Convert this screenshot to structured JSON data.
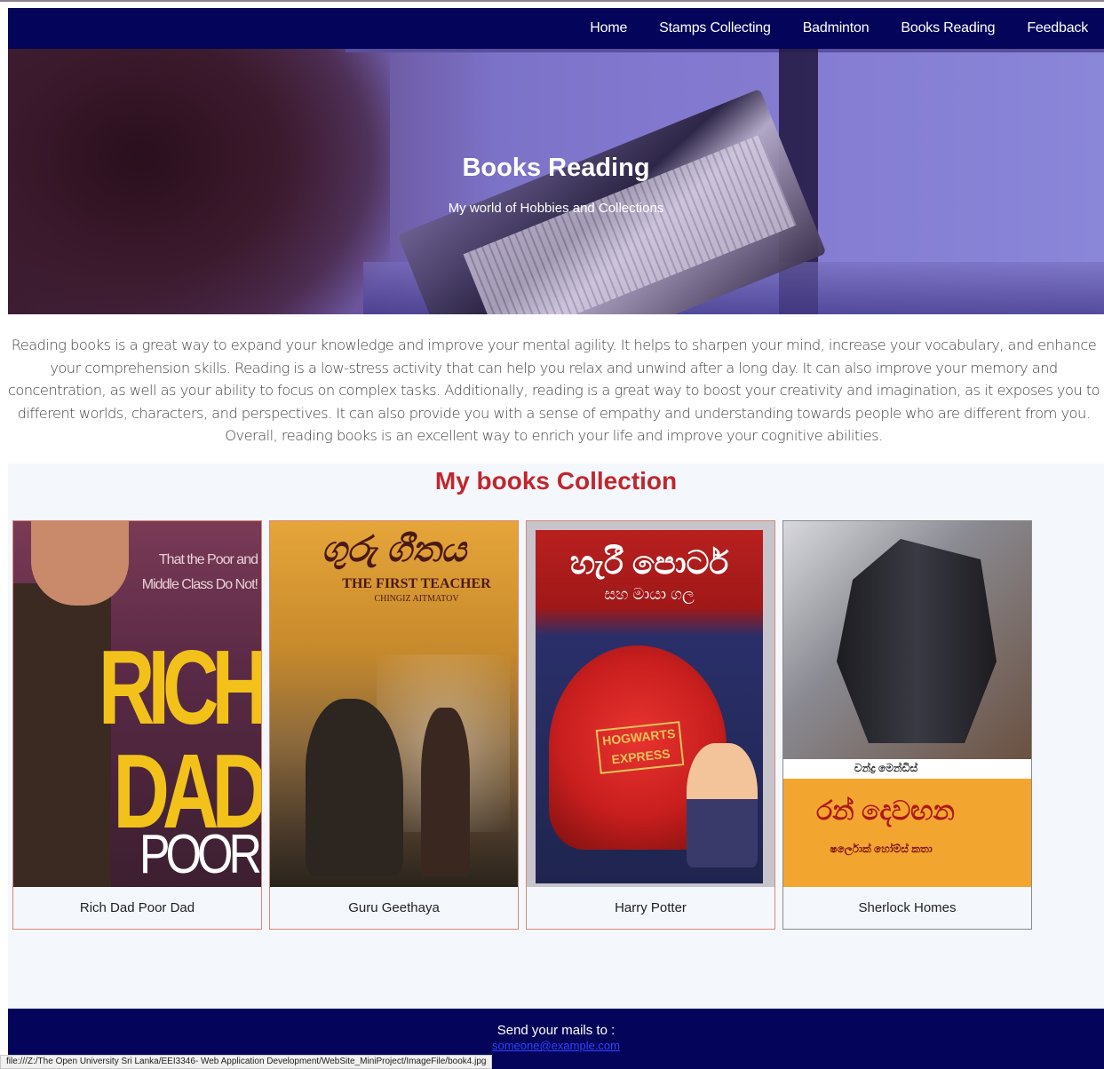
{
  "nav": {
    "items": [
      "Home",
      "Stamps Collecting",
      "Badminton",
      "Books Reading",
      "Feedback"
    ]
  },
  "hero": {
    "title": "Books Reading",
    "subtitle": "My world of Hobbies and Collections"
  },
  "intro": {
    "text": "Reading books is a great way to expand your knowledge and improve your mental agility. It helps to sharpen your mind, increase your vocabulary, and enhance your comprehension skills. Reading is a low-stress activity that can help you relax and unwind after a long day. It can also improve your memory and concentration, as well as your ability to focus on complex tasks. Additionally, reading is a great way to boost your creativity and imagination, as it exposes you to different worlds, characters, and perspectives. It can also provide you with a sense of empathy and understanding towards people who are different from you. Overall, reading books is an excellent way to enrich your life and improve your cognitive abilities."
  },
  "collection": {
    "title": "My books Collection",
    "books": [
      {
        "caption": "Rich Dad Poor Dad",
        "cover_tagline": "That the Poor and Middle Class Do Not!",
        "cover_word1": "RICH",
        "cover_word2": "DAD",
        "cover_word3": "POOR DAD"
      },
      {
        "caption": "Guru Geethaya",
        "cover_script": "ගුරු ගීතය",
        "cover_title_en": "THE FIRST TEACHER",
        "cover_author": "CHINGIZ AITMATOV"
      },
      {
        "caption": "Harry Potter",
        "cover_title_si": "හැරී පොටර්",
        "cover_subtitle_si": "සහ මායා ගල",
        "cover_plate": "HOGWARTS EXPRESS"
      },
      {
        "caption": "Sherlock Homes",
        "cover_author_si": "චන්ද්‍ර මෙන්ඩිස්",
        "cover_title_si": "රන් දෙවඟන",
        "cover_subtitle_si": "ෂර්ලොක් හෝම්ස් කතා"
      }
    ]
  },
  "footer": {
    "text": "Send your mails to :",
    "email": "someone@example.com"
  },
  "status": {
    "url": "file:///Z:/The Open University Sri Lanka/EEI3346- Web Application Development/WebSite_MiniProject/ImageFile/book4.jpg"
  },
  "colors": {
    "navbar": "#04045a",
    "accent_title": "#c0272d",
    "collection_bg": "#f4f7fc",
    "card_border": "#d98878"
  }
}
